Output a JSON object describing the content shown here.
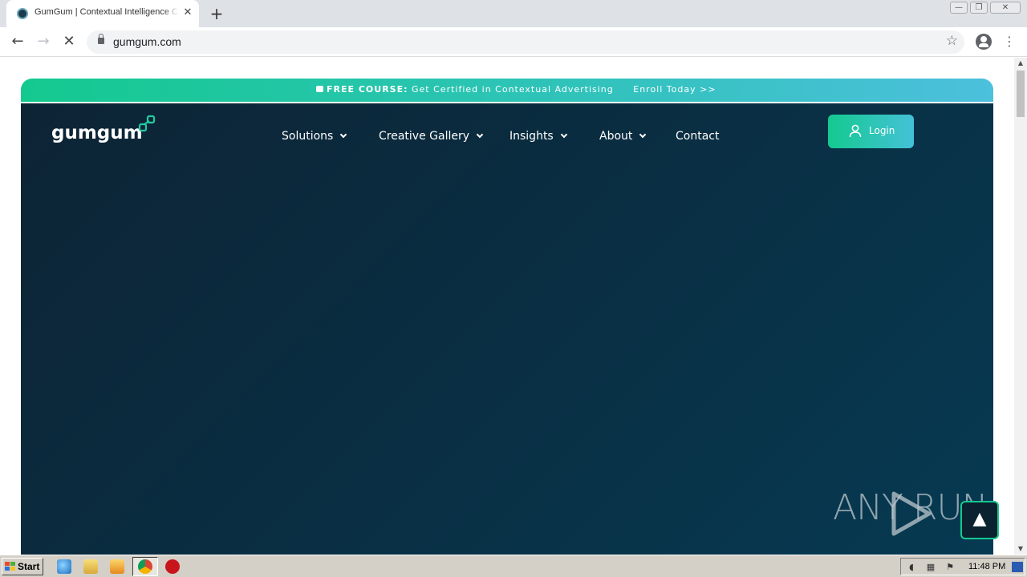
{
  "browser": {
    "tab_title": "GumGum | Contextual Intelligence C",
    "tab_close": "✕",
    "new_tab": "+",
    "url": "gumgum.com",
    "window_controls": [
      "—",
      "❐",
      "✕"
    ]
  },
  "page": {
    "promo": {
      "label": "FREE COURSE:",
      "text": "Get Certified in Contextual Advertising",
      "cta": "Enroll Today >>"
    },
    "logo": "gumgum",
    "nav": [
      {
        "label": "Solutions",
        "has_dropdown": true
      },
      {
        "label": "Creative Gallery",
        "has_dropdown": true
      },
      {
        "label": "Insights",
        "has_dropdown": true
      },
      {
        "label": "About",
        "has_dropdown": true
      },
      {
        "label": "Contact",
        "has_dropdown": false
      }
    ],
    "login_label": "Login",
    "watermark": "ANY RUN",
    "colors": {
      "accent_start": "#14c98f",
      "accent_end": "#4cc0dc",
      "hero": "#0a2d41"
    }
  },
  "taskbar": {
    "start_label": "Start",
    "clock": "11:48 PM"
  }
}
